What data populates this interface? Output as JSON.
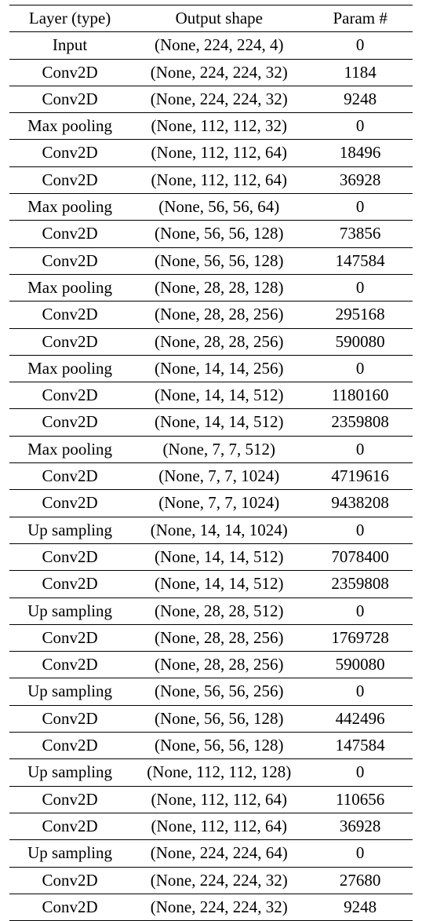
{
  "chart_data": {
    "type": "table",
    "headers": [
      "Layer (type)",
      "Output shape",
      "Param #"
    ],
    "rows": [
      {
        "layer": "Input",
        "shape": "(None, 224, 224, 4)",
        "params": "0"
      },
      {
        "layer": "Conv2D",
        "shape": "(None, 224, 224, 32)",
        "params": "1184"
      },
      {
        "layer": "Conv2D",
        "shape": "(None, 224, 224, 32)",
        "params": "9248"
      },
      {
        "layer": "Max pooling",
        "shape": "(None, 112, 112, 32)",
        "params": "0"
      },
      {
        "layer": "Conv2D",
        "shape": "(None, 112, 112, 64)",
        "params": "18496"
      },
      {
        "layer": "Conv2D",
        "shape": "(None, 112, 112, 64)",
        "params": "36928"
      },
      {
        "layer": "Max pooling",
        "shape": "(None, 56, 56, 64)",
        "params": "0"
      },
      {
        "layer": "Conv2D",
        "shape": "(None, 56, 56, 128)",
        "params": "73856"
      },
      {
        "layer": "Conv2D",
        "shape": "(None, 56, 56, 128)",
        "params": "147584"
      },
      {
        "layer": "Max pooling",
        "shape": "(None, 28, 28, 128)",
        "params": "0"
      },
      {
        "layer": "Conv2D",
        "shape": "(None, 28, 28, 256)",
        "params": "295168"
      },
      {
        "layer": "Conv2D",
        "shape": "(None, 28, 28, 256)",
        "params": "590080"
      },
      {
        "layer": "Max pooling",
        "shape": "(None, 14, 14, 256)",
        "params": "0"
      },
      {
        "layer": "Conv2D",
        "shape": "(None, 14, 14, 512)",
        "params": "1180160"
      },
      {
        "layer": "Conv2D",
        "shape": "(None, 14, 14, 512)",
        "params": "2359808"
      },
      {
        "layer": "Max pooling",
        "shape": "(None, 7, 7, 512)",
        "params": "0"
      },
      {
        "layer": "Conv2D",
        "shape": "(None, 7, 7, 1024)",
        "params": "4719616"
      },
      {
        "layer": "Conv2D",
        "shape": "(None, 7, 7, 1024)",
        "params": "9438208"
      },
      {
        "layer": "Up sampling",
        "shape": "(None, 14, 14, 1024)",
        "params": "0"
      },
      {
        "layer": "Conv2D",
        "shape": "(None, 14, 14, 512)",
        "params": "7078400"
      },
      {
        "layer": "Conv2D",
        "shape": "(None, 14, 14, 512)",
        "params": "2359808"
      },
      {
        "layer": "Up sampling",
        "shape": "(None, 28, 28, 512)",
        "params": "0"
      },
      {
        "layer": "Conv2D",
        "shape": "(None, 28, 28, 256)",
        "params": "1769728"
      },
      {
        "layer": "Conv2D",
        "shape": "(None, 28, 28, 256)",
        "params": "590080"
      },
      {
        "layer": "Up sampling",
        "shape": "(None, 56, 56, 256)",
        "params": "0"
      },
      {
        "layer": "Conv2D",
        "shape": "(None, 56, 56, 128)",
        "params": "442496"
      },
      {
        "layer": "Conv2D",
        "shape": "(None, 56, 56, 128)",
        "params": "147584"
      },
      {
        "layer": "Up sampling",
        "shape": "(None, 112, 112, 128)",
        "params": "0"
      },
      {
        "layer": "Conv2D",
        "shape": "(None, 112, 112, 64)",
        "params": "110656"
      },
      {
        "layer": "Conv2D",
        "shape": "(None, 112, 112, 64)",
        "params": "36928"
      },
      {
        "layer": "Up sampling",
        "shape": "(None, 224, 224, 64)",
        "params": "0"
      },
      {
        "layer": "Conv2D",
        "shape": "(None, 224, 224, 32)",
        "params": "27680"
      },
      {
        "layer": "Conv2D",
        "shape": "(None, 224, 224, 32)",
        "params": "9248"
      }
    ]
  }
}
